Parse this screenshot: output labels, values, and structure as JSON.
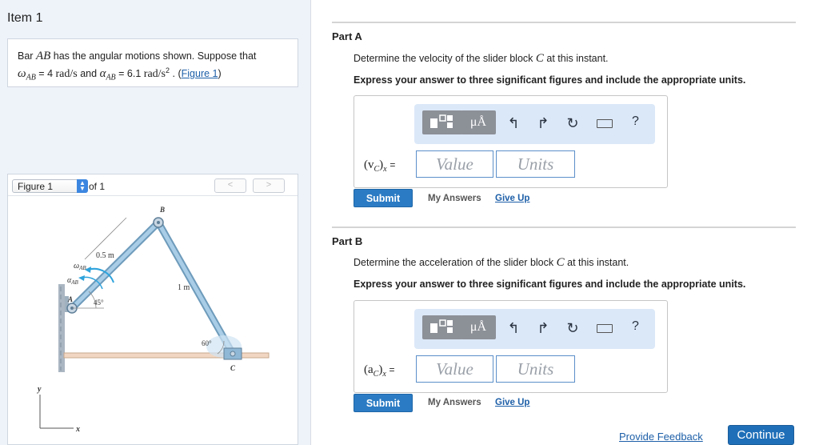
{
  "item": {
    "title": "Item 1"
  },
  "problem": {
    "text_pre": "Bar",
    "bar_name": "AB",
    "text_mid": "has the angular motions shown. Suppose that",
    "omega_sym": "ω",
    "omega_sub": "AB",
    "omega_val": "= 4",
    "omega_unit": "rad/s",
    "and": "and",
    "alpha_sym": "α",
    "alpha_sub": "AB",
    "alpha_val": "= 6.1",
    "alpha_unit": "rad/s",
    "alpha_unit_exp": "2",
    "period": ".",
    "figure_link_open": "(",
    "figure_link": "Figure 1",
    "figure_link_close": ")"
  },
  "figure": {
    "select_label": "Figure 1",
    "of_label": "of 1",
    "prev": "<",
    "next": ">",
    "labels": {
      "B": "B",
      "len_ab": "0.5 m",
      "omega": "ω",
      "omega_sub": "AB",
      "alpha": "α",
      "alpha_sub": "AB",
      "A": "A",
      "angle45": "45°",
      "len_bc": "1 m",
      "angle60": "60°",
      "C": "C",
      "y": "y",
      "x": "x"
    }
  },
  "part_a": {
    "title": "Part A",
    "prompt_pre": "Determine the velocity of the slider block",
    "prompt_var": "C",
    "prompt_post": "at this instant.",
    "instructions": "Express your answer to three significant figures and include the appropriate units.",
    "answer_label": "(v",
    "answer_label_sub": "C",
    "answer_label_close": ")",
    "answer_label_xsub": "x",
    "equals": "=",
    "value_placeholder": "Value",
    "units_placeholder": "Units",
    "submit": "Submit",
    "my_answers": "My Answers",
    "give_up": "Give Up"
  },
  "part_b": {
    "title": "Part B",
    "prompt_pre": "Determine the acceleration of the slider block",
    "prompt_var": "C",
    "prompt_post": "at this instant.",
    "instructions": "Express your answer to three significant figures and include the appropriate units.",
    "answer_label": "(a",
    "answer_label_sub": "C",
    "answer_label_close": ")",
    "answer_label_xsub": "x",
    "equals": "=",
    "value_placeholder": "Value",
    "units_placeholder": "Units",
    "submit": "Submit",
    "my_answers": "My Answers",
    "give_up": "Give Up"
  },
  "toolbar": {
    "units_label": "μÅ",
    "help": "?",
    "icons": [
      "templates-icon",
      "units-icon",
      "undo-icon",
      "redo-icon",
      "reset-icon",
      "keyboard-icon",
      "help-icon"
    ]
  },
  "footer": {
    "feedback": "Provide Feedback",
    "continue": "Continue"
  },
  "colors": {
    "accent": "#2b7bc4",
    "panel": "#eef3fa",
    "toolbar": "#dbe8f8",
    "bar": "#8fb8d6"
  }
}
